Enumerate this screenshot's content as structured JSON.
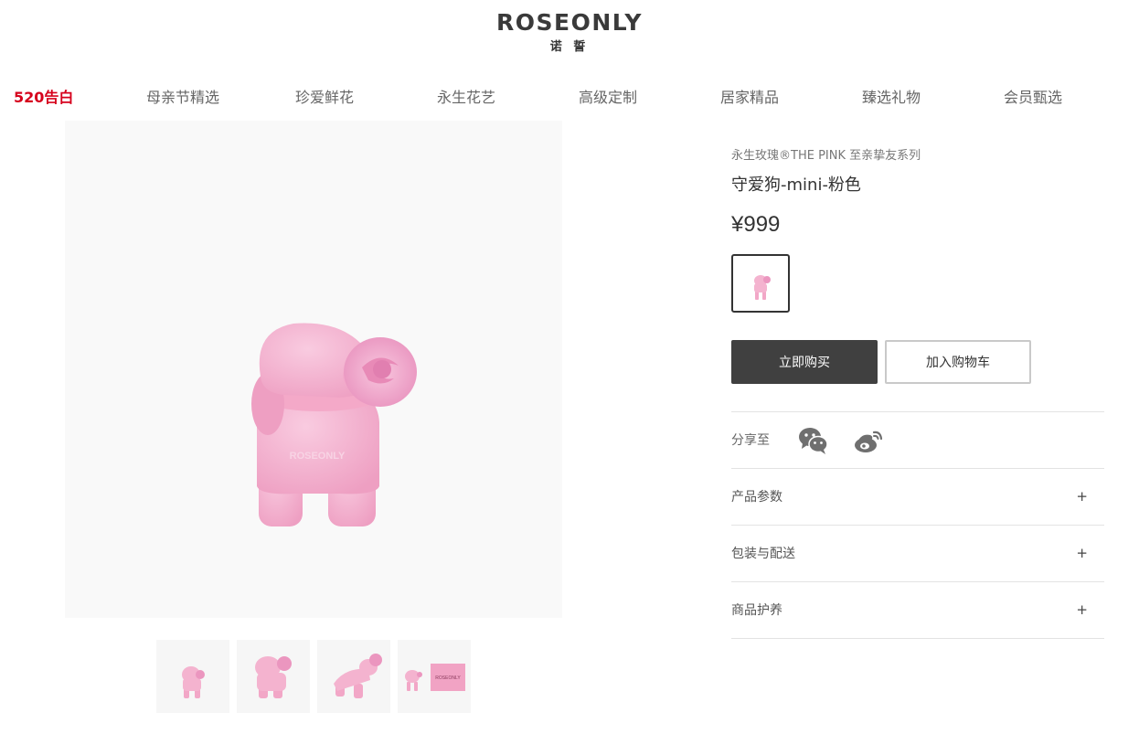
{
  "brand": {
    "name": "ROSEONLY",
    "subtitle": "诺 誓"
  },
  "nav": [
    {
      "label": "520告白",
      "active": true
    },
    {
      "label": "母亲节精选"
    },
    {
      "label": "珍爱鲜花"
    },
    {
      "label": "永生花艺"
    },
    {
      "label": "高级定制"
    },
    {
      "label": "居家精品"
    },
    {
      "label": "臻选礼物"
    },
    {
      "label": "会员甄选"
    }
  ],
  "product": {
    "series": "永生玫瑰®THE PINK 至亲挚友系列",
    "title": "守爱狗-mini-粉色",
    "price": "¥999",
    "figure_logo": "ROSEONLY",
    "box_logo": "ROSEONLY"
  },
  "actions": {
    "buy_label": "立即购买",
    "cart_label": "加入购物车"
  },
  "share": {
    "label": "分享至",
    "icons": [
      "wechat-icon",
      "weibo-icon"
    ]
  },
  "accordion": [
    {
      "label": "产品参数",
      "toggle": "+"
    },
    {
      "label": "包装与配送",
      "toggle": "+"
    },
    {
      "label": "商品护养",
      "toggle": "+"
    }
  ],
  "colors": {
    "accent_red": "#d6001c",
    "product_pink": "#f5b6cf",
    "buy_button": "#404040",
    "icon_gray": "#6f6f6f"
  }
}
